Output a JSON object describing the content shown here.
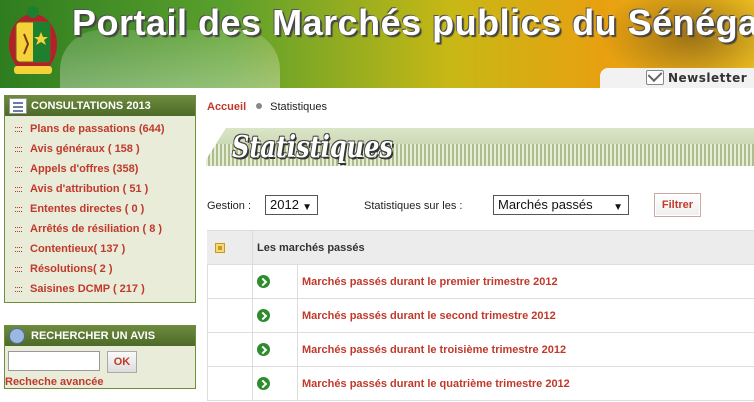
{
  "header": {
    "title": "Portail des Marchés publics du Sénégal",
    "newsletter_label": "Newsletter"
  },
  "sidebar": {
    "consultations_title": "CONSULTATIONS 2013",
    "items": [
      {
        "label": "Plans de passations (644)"
      },
      {
        "label": "Avis généraux ( 158 )"
      },
      {
        "label": "Appels d'offres (358)"
      },
      {
        "label": "Avis d'attribution ( 51 )"
      },
      {
        "label": "Ententes directes ( 0 )"
      },
      {
        "label": "Arrêtés de résiliation ( 8 )"
      },
      {
        "label": "Contentieux( 137 )"
      },
      {
        "label": "Résolutions( 2 )"
      },
      {
        "label": "Saisines DCMP ( 217 )"
      }
    ],
    "search_title": "RECHERCHER UN AVIS",
    "search_value": "",
    "ok_label": "OK",
    "advanced_label": "Recheche avancée"
  },
  "breadcrumb": {
    "home": "Accueil",
    "current": "Statistiques"
  },
  "page_title": "Statistiques",
  "filters": {
    "gestion_label": "Gestion :",
    "gestion_value": "2012",
    "stats_label": "Statistiques sur les :",
    "stats_value": "Marchés passés",
    "filter_button": "Filtrer"
  },
  "table": {
    "header": "Les marchés passés",
    "rows": [
      {
        "label": "Marchés passés durant le premier trimestre 2012"
      },
      {
        "label": "Marchés passés durant le second trimestre 2012"
      },
      {
        "label": "Marchés passés durant le troisième trimestre 2012"
      },
      {
        "label": "Marchés passés durant le quatrième trimestre 2012"
      }
    ]
  },
  "colors": {
    "accent_red": "#c0392b",
    "sidebar_green": "#5b7a31",
    "sidebar_bg": "#e9ecd9"
  }
}
